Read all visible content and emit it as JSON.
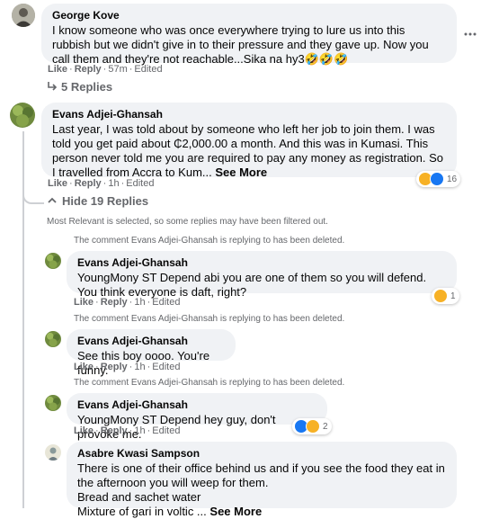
{
  "colors": {
    "bubble": "#f0f2f5",
    "muted": "#65676b",
    "text": "#050505",
    "like_blue": "#1877f2",
    "haha_yellow": "#f7b125"
  },
  "comment1": {
    "author": "George Kove",
    "text_parts": [
      "I know someone who was once everywhere trying to lure us into this rubbish but we didn't give in to their pressure and they gave up. Now you call them and they're not reachable...Sika na hy3",
      "🤣🤣🤣"
    ],
    "like": "Like",
    "reply": "Reply",
    "time": "57m",
    "edited": "Edited",
    "replies_toggle": "5 Replies",
    "more_icon": "more-horizontal-icon"
  },
  "comment2": {
    "author": "Evans Adjei-Ghansah",
    "text": "Last year, I was told about by someone who left her job to join them. I was told you get paid about ₵2,000.00 a month. And this was in Kumasi. This person never told me you are required to pay any money as registration. So I travelled from Accra to Kum...",
    "see_more": "See More",
    "like": "Like",
    "reply": "Reply",
    "time": "1h",
    "edited": "Edited",
    "reaction_count": "16",
    "reactions": [
      "haha",
      "like"
    ],
    "hide_toggle": "Hide 19 Replies",
    "filter_note": "Most Relevant is selected, so some replies may have been filtered out."
  },
  "replies": [
    {
      "deleted_note": "The comment Evans Adjei-Ghansah is replying to has been deleted.",
      "author": "Evans Adjei-Ghansah",
      "text": "YoungMony ST Depend abi you are one of them so you will defend. You think everyone is daft, right?",
      "like": "Like",
      "reply": "Reply",
      "time": "1h",
      "edited": "Edited",
      "reaction_count": "1",
      "reactions": [
        "haha"
      ]
    },
    {
      "deleted_note": "The comment Evans Adjei-Ghansah is replying to has been deleted.",
      "author": "Evans Adjei-Ghansah",
      "text": "See this boy oooo. You're funny.",
      "like": "Like",
      "reply": "Reply",
      "time": "1h",
      "edited": "Edited"
    },
    {
      "deleted_note": "The comment Evans Adjei-Ghansah is replying to has been deleted.",
      "author": "Evans Adjei-Ghansah",
      "text": "YoungMony ST Depend hey guy, don't provoke me.",
      "like": "Like",
      "reply": "Reply",
      "time": "1h",
      "edited": "Edited",
      "reaction_count": "2",
      "reactions": [
        "like",
        "haha"
      ]
    },
    {
      "author": "Asabre Kwasi Sampson",
      "lines": [
        "There is one of their office behind us and if you see the food they eat in the afternoon you will weep for them.",
        "Bread and sachet water",
        "Mixture of gari in voltic ..."
      ],
      "see_more": "See More"
    }
  ]
}
